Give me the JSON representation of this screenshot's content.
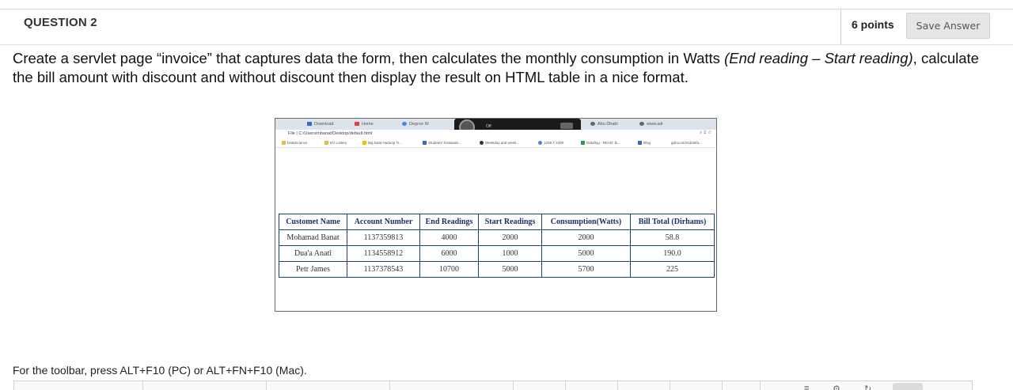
{
  "question": {
    "title": "QUESTION 2",
    "points": "6 points",
    "save_label": "Save Answer",
    "text_part1": "Create a servlet page “invoice” that captures data the form, then calculates the monthly consumption in Watts ",
    "text_italic": "(End reading – Start reading)",
    "text_part2": ", calculate the bill amount with discount and without discount then display the result on HTML table in a nice format."
  },
  "browser": {
    "tabs": [
      "Download",
      "Home",
      "Degree W",
      "Abu Dhabi",
      "www.adr"
    ],
    "overlay_label": "Off",
    "address": "File | C:/Users/mbanat/Desktop/default.html",
    "bookmarks": [
      "DataScience",
      "DV Lottery",
      "Big Data Hadoop Tr...",
      "Students' Evaluatio...",
      "Weekday and week...",
      "1208 × 2400",
      "Dataflog - READ: B...",
      "Blog",
      "gdrucom/md/defa..."
    ]
  },
  "result_table": {
    "headers": [
      "Customet Name",
      "Account Number",
      "End Readings",
      "Start Readings",
      "Consumption(Watts)",
      "Bill Total (Dirhams)"
    ],
    "rows": [
      [
        "Mohamad Banat",
        "1137359813",
        "4000",
        "2000",
        "2000",
        "58.8"
      ],
      [
        "Dua'a Anati",
        "1134558912",
        "6000",
        "1000",
        "5000",
        "190.0"
      ],
      [
        "Petr James",
        "1137378543",
        "10700",
        "5000",
        "5700",
        "225"
      ]
    ]
  },
  "toolbar_note": "For the toolbar, press ALT+F10 (PC) or ALT+FN+F10 (Mac).",
  "colors": {
    "table_border": "#1f3f7a",
    "header_text": "#1a2f66",
    "save_bg": "#e6e6e6"
  },
  "icons": [
    "gear-icon",
    "star-icon",
    "share-icon",
    "reload-icon"
  ]
}
